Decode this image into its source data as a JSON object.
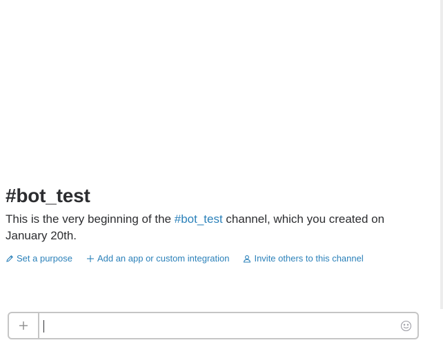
{
  "channel": {
    "title": "#bot_test",
    "intro_before": "This is the very beginning of the ",
    "intro_link": "#bot_test",
    "intro_after": " channel, which you created on January 20th."
  },
  "actions": [
    {
      "label": "Set a purpose",
      "icon": "pencil-icon"
    },
    {
      "label": "Add an app or custom integration",
      "icon": "plus-icon"
    },
    {
      "label": "Invite others to this channel",
      "icon": "person-icon"
    }
  ],
  "composer": {
    "placeholder": "",
    "add_icon": "plus-icon",
    "emoji_icon": "smiley-icon"
  },
  "colors": {
    "link": "#2a80b9",
    "text": "#2c2d30",
    "border": "#c5c5c5"
  }
}
